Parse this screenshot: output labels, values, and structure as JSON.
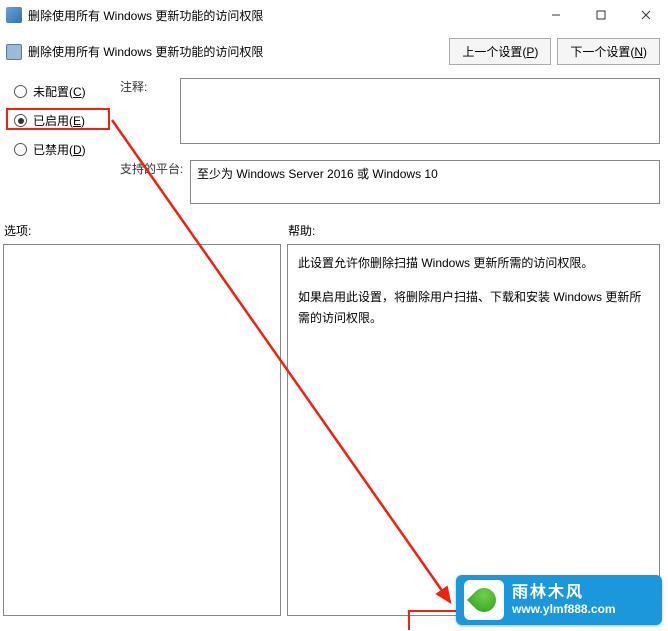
{
  "window": {
    "title": "删除使用所有 Windows 更新功能的访问权限"
  },
  "header": {
    "subtitle": "删除使用所有 Windows 更新功能的访问权限",
    "prev_btn": "上一个设置(P)",
    "next_btn": "下一个设置(N)"
  },
  "radios": {
    "not_configured": "未配置(C)",
    "enabled": "已启用(E)",
    "disabled": "已禁用(D)"
  },
  "labels": {
    "comment": "注释:",
    "supported": "支持的平台:",
    "options": "选项:",
    "help": "帮助:"
  },
  "supported_text": "至少为 Windows Server 2016 或 Windows 10",
  "help": {
    "p1": "此设置允许你删除扫描 Windows 更新所需的访问权限。",
    "p2": "如果启用此设置，将删除用户扫描、下载和安装 Windows 更新所需的访问权限。"
  },
  "badge": {
    "brand": "雨林木风",
    "url": "www.ylmf888.com"
  }
}
